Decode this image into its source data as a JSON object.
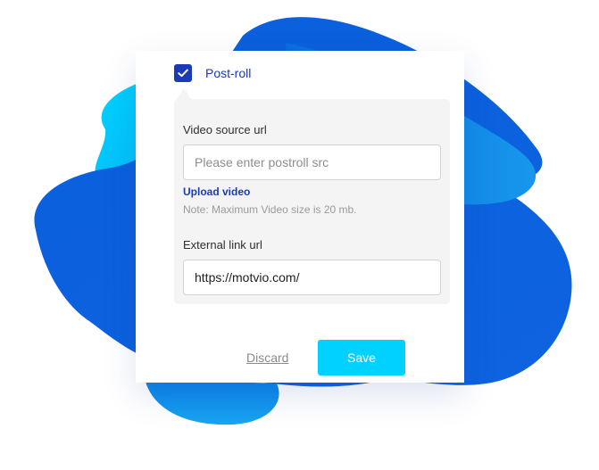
{
  "post_roll": {
    "checkbox_checked": true,
    "label": "Post-roll"
  },
  "video_source": {
    "label": "Video source url",
    "value": "",
    "placeholder": "Please enter postroll src"
  },
  "upload": {
    "link_text": "Upload video",
    "note": "Note: Maximum Video size is 20 mb."
  },
  "external_link": {
    "label": "External link url",
    "value": "https://motvio.com/"
  },
  "actions": {
    "discard_label": "Discard",
    "save_label": "Save"
  },
  "colors": {
    "checkbox_fill": "#1a3bb5",
    "label_blue": "#1a3bb5",
    "save_button": "#00d1ff",
    "panel_background": "#f4f4f4",
    "blob_light_blue": "#00c8ff",
    "blob_mid_blue": "#0b8be6",
    "blob_dark_blue": "#0a5ad8"
  },
  "icons": {
    "checkbox": "checkmark-icon"
  }
}
